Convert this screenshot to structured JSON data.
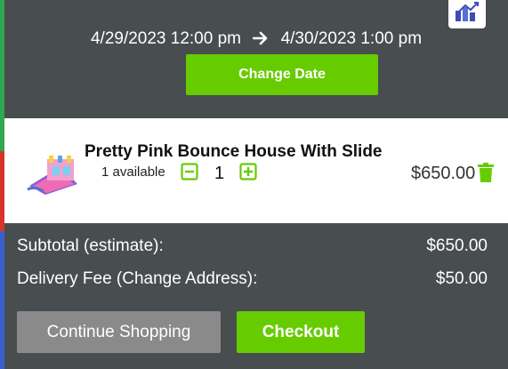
{
  "colors": {
    "accent_green": "#66cc00",
    "panel_bg": "#484d50",
    "secondary_button": "#8a8a8a"
  },
  "icons": [
    "brand-logo-icon",
    "arrow-right-icon",
    "bounce-house-image",
    "minus-square-icon",
    "plus-square-icon",
    "trash-icon"
  ],
  "dates": {
    "start": "4/29/2023 12:00 pm",
    "end": "4/30/2023 1:00 pm",
    "change_label": "Change Date"
  },
  "item": {
    "name": "Pretty Pink Bounce House With Slide",
    "availability": "1 available",
    "quantity": "1",
    "price": "$650.00"
  },
  "summary": {
    "subtotal_label": "Subtotal (estimate):",
    "subtotal_value": "$650.00",
    "delivery_label": "Delivery Fee (Change Address):",
    "delivery_value": "$50.00"
  },
  "actions": {
    "continue_label": "Continue Shopping",
    "checkout_label": "Checkout"
  }
}
